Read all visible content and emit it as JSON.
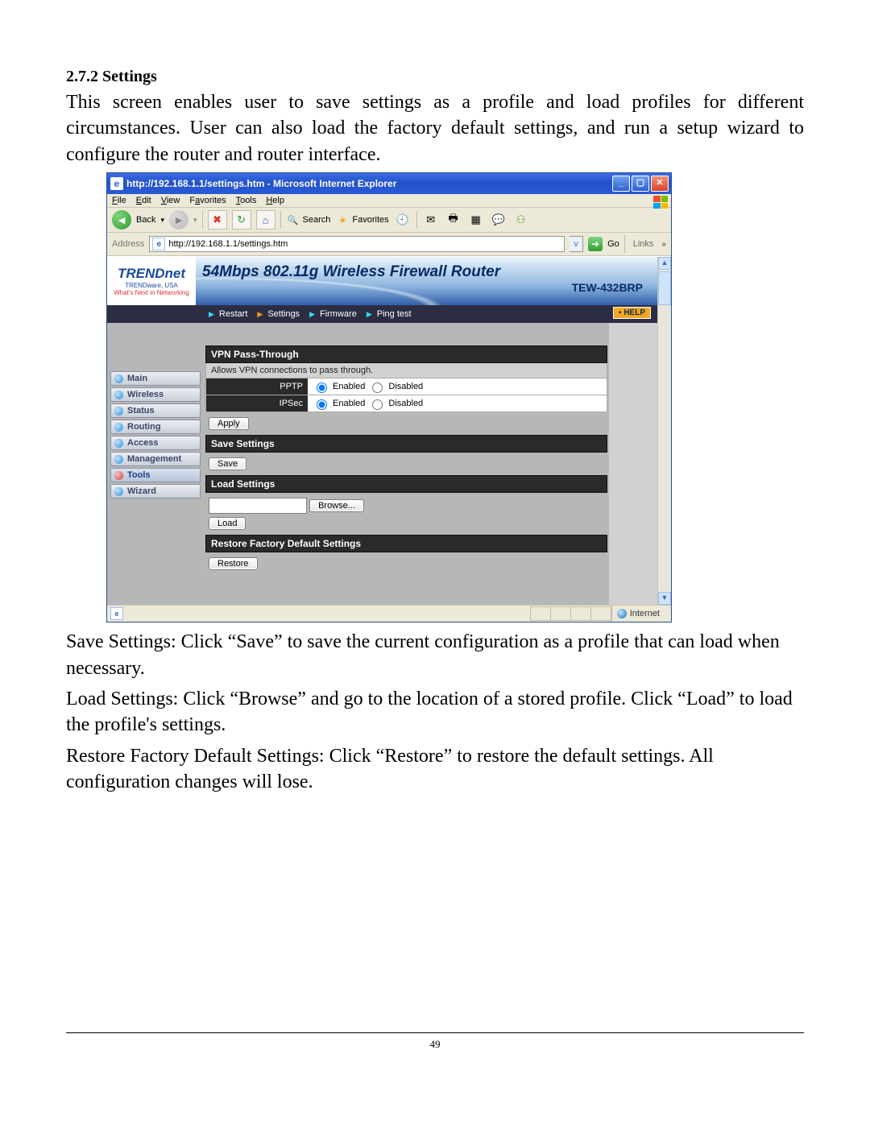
{
  "doc": {
    "heading": "2.7.2  Settings",
    "intro": "This screen enables user to save settings as a profile and load profiles for different circumstances. User can also load the factory default settings, and run a setup wizard to configure the router and router interface.",
    "para_save": "Save Settings: Click “Save” to save the current configuration as a profile that can load when necessary.",
    "para_load": "Load Settings: Click “Browse” and go to the location of a stored profile. Click “Load” to load the profile's settings.",
    "para_restore": "Restore Factory Default Settings: Click “Restore” to restore the default settings. All configuration changes will lose.",
    "page_number": "49"
  },
  "browser": {
    "title": "http://192.168.1.1/settings.htm - Microsoft Internet Explorer",
    "menus": {
      "file": "File",
      "edit": "Edit",
      "view": "View",
      "favorites": "Favorites",
      "tools": "Tools",
      "help": "Help"
    },
    "toolbar": {
      "back": "Back",
      "search": "Search",
      "favorites": "Favorites"
    },
    "address_label": "Address",
    "address_value": "http://192.168.1.1/settings.htm",
    "go": "Go",
    "links": "Links",
    "status_zone": "Internet"
  },
  "router": {
    "brand": "TRENDnet",
    "brand_sub": "TRENDware, USA",
    "brand_tag": "What's Next in Networking",
    "banner_title": "54Mbps 802.11g Wireless Firewall Router",
    "banner_model": "TEW-432BRP",
    "subnav": {
      "restart": "Restart",
      "settings": "Settings",
      "firmware": "Firmware",
      "ping": "Ping test",
      "help": "HELP"
    },
    "sidebar": [
      "Main",
      "Wireless",
      "Status",
      "Routing",
      "Access",
      "Management",
      "Tools",
      "Wizard"
    ],
    "sidebar_active_index": 6,
    "sections": {
      "vpn": {
        "title": "VPN Pass-Through",
        "desc": "Allows VPN connections to pass through.",
        "rows": [
          {
            "label": "PPTP",
            "enabled": "Enabled",
            "disabled": "Disabled",
            "sel": "enabled"
          },
          {
            "label": "IPSec",
            "enabled": "Enabled",
            "disabled": "Disabled",
            "sel": "enabled"
          }
        ],
        "apply": "Apply"
      },
      "save": {
        "title": "Save Settings",
        "button": "Save"
      },
      "load": {
        "title": "Load Settings",
        "browse": "Browse...",
        "button": "Load"
      },
      "restore": {
        "title": "Restore Factory Default Settings",
        "button": "Restore"
      }
    }
  }
}
